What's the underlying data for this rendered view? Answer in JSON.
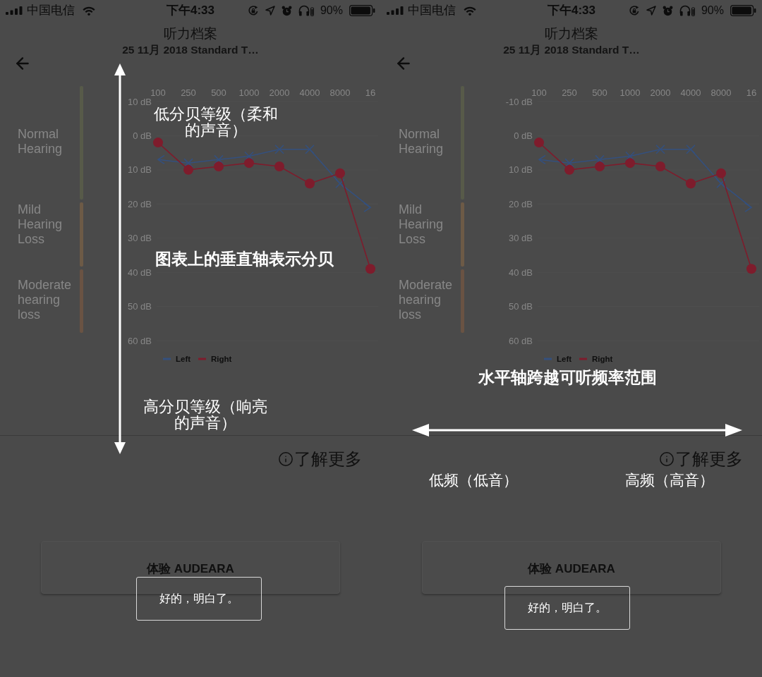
{
  "panels": [
    {
      "status_bar": {
        "carrier": "中国电信",
        "time": "下午4:33",
        "battery": "90%"
      },
      "header": {
        "title": "听力档案",
        "subtitle": "25 11月 2018 Standard T…"
      },
      "hearing_ranges": [
        {
          "label": "Normal Hearing",
          "color": "#575a49"
        },
        {
          "label": "Mild Hearing Loss",
          "color": "#6d5a46"
        },
        {
          "label": "Moderate hearing loss",
          "color": "#6a5343"
        }
      ],
      "chart_data": {
        "type": "line",
        "categories": [
          "100",
          "250",
          "500",
          "1000",
          "2000",
          "4000",
          "8000",
          "16"
        ],
        "series": [
          {
            "name": "Left",
            "color": "#34507e",
            "marker": "x",
            "values": [
              7,
              8,
              7,
              6,
              4,
              4,
              14,
              21
            ]
          },
          {
            "name": "Right",
            "color": "#7e1c2c",
            "marker": "circle",
            "values": [
              2,
              10,
              9,
              8,
              9,
              14,
              11,
              39
            ]
          }
        ],
        "legend": "bottom",
        "ylim": [
          60,
          -10
        ],
        "yticks": [
          {
            "value": -10,
            "label": "10 dB"
          },
          {
            "value": 0,
            "label": "0 dB"
          },
          {
            "value": 10,
            "label": "10 dB"
          },
          {
            "value": 20,
            "label": "20 dB"
          },
          {
            "value": 30,
            "label": "30 dB"
          },
          {
            "value": 40,
            "label": "40 dB"
          },
          {
            "value": 50,
            "label": "50 dB"
          },
          {
            "value": 60,
            "label": "60 dB"
          }
        ]
      },
      "learn_more": "了解更多",
      "action_button": "体验 AUDEARA",
      "tutorial": {
        "kind": "vertical",
        "low_end": "低分贝等级（柔和的声音）",
        "caption": "图表上的垂直轴表示分贝",
        "high_end": "高分贝等级（响亮的声音）",
        "dismiss": "好的，明白了。"
      }
    },
    {
      "status_bar": {
        "carrier": "中国电信",
        "time": "下午4:33",
        "battery": "90%"
      },
      "header": {
        "title": "听力档案",
        "subtitle": "25 11月 2018 Standard T…"
      },
      "hearing_ranges": [
        {
          "label": "Normal Hearing",
          "color": "#575a49"
        },
        {
          "label": "Mild Hearing Loss",
          "color": "#6d5a46"
        },
        {
          "label": "Moderate hearing loss",
          "color": "#6a5343"
        }
      ],
      "chart_data": {
        "type": "line",
        "categories": [
          "100",
          "250",
          "500",
          "1000",
          "2000",
          "4000",
          "8000",
          "16"
        ],
        "series": [
          {
            "name": "Left",
            "color": "#34507e",
            "marker": "x",
            "values": [
              7,
              8,
              7,
              6,
              4,
              4,
              14,
              21
            ]
          },
          {
            "name": "Right",
            "color": "#7e1c2c",
            "marker": "circle",
            "values": [
              2,
              10,
              9,
              8,
              9,
              14,
              11,
              39
            ]
          }
        ],
        "legend": "bottom",
        "ylim": [
          60,
          -10
        ],
        "yticks": [
          {
            "value": -10,
            "label": "-10 dB"
          },
          {
            "value": 0,
            "label": "0 dB"
          },
          {
            "value": 10,
            "label": "10 dB"
          },
          {
            "value": 20,
            "label": "20 dB"
          },
          {
            "value": 30,
            "label": "30 dB"
          },
          {
            "value": 40,
            "label": "40 dB"
          },
          {
            "value": 50,
            "label": "50 dB"
          },
          {
            "value": 60,
            "label": "60 dB"
          }
        ]
      },
      "learn_more": "了解更多",
      "action_button": "体验 AUDEARA",
      "tutorial": {
        "kind": "horizontal",
        "caption": "水平轴跨越可听频率范围",
        "low_end": "低频（低音）",
        "high_end": "高频（高音）",
        "dismiss": "好的，明白了。"
      }
    }
  ]
}
